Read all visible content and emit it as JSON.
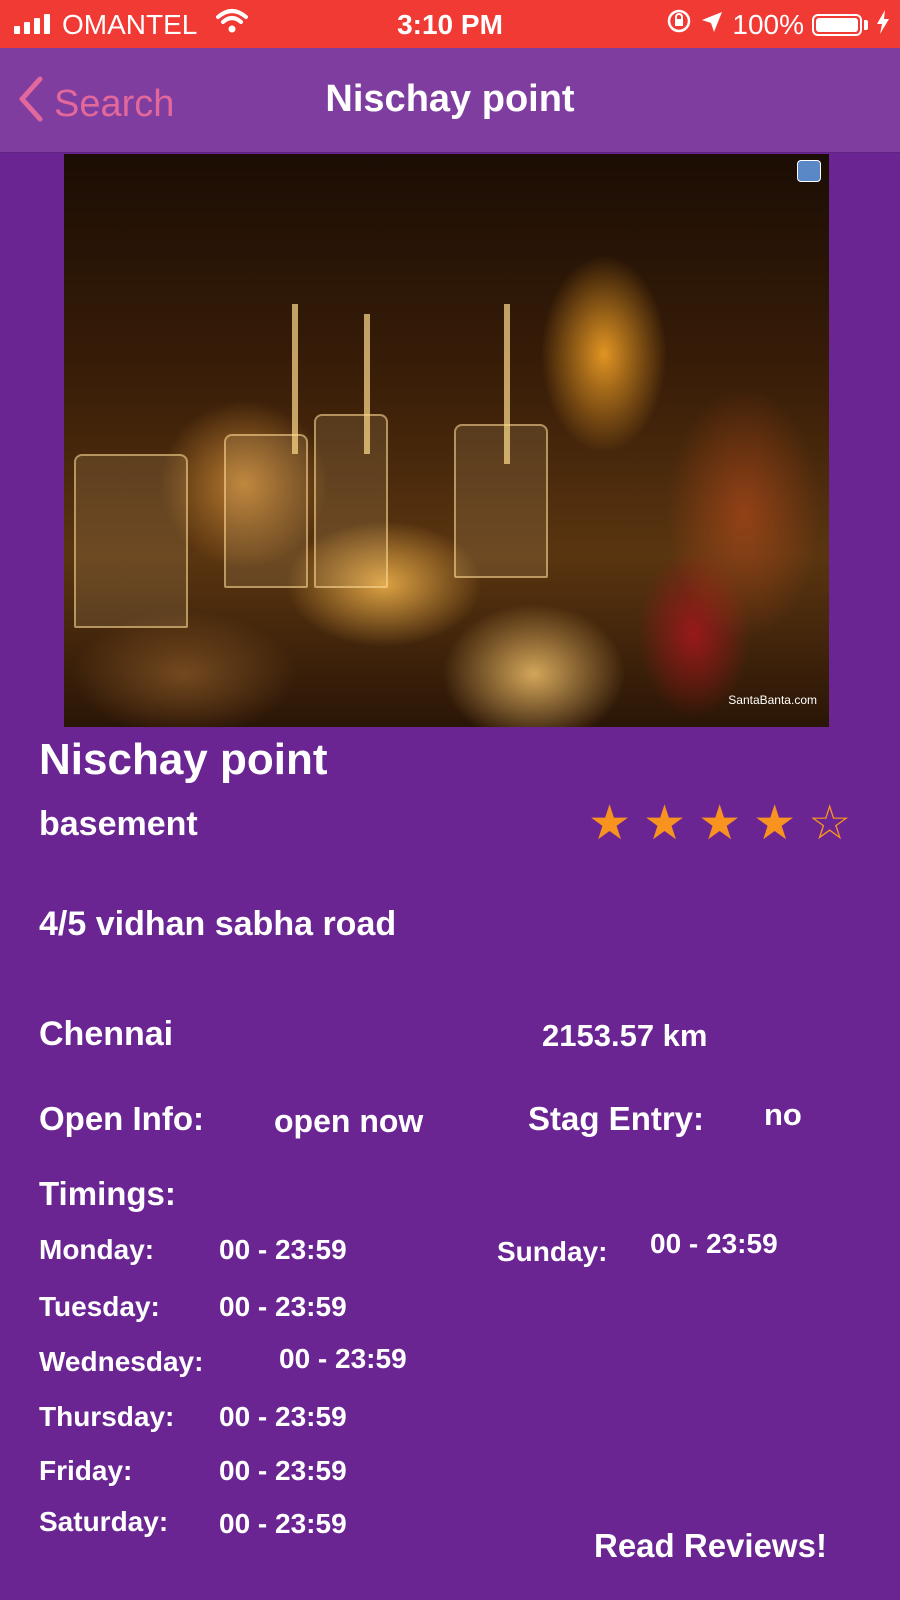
{
  "status_bar": {
    "carrier": "OMANTEL",
    "time": "3:10 PM",
    "battery_text": "100%",
    "battery_level": 1.0
  },
  "nav": {
    "back_label": "Search",
    "title": "Nischay point"
  },
  "hero": {
    "watermark": "SantaBanta.com"
  },
  "place": {
    "name": "Nischay point",
    "area": "basement",
    "rating": 4,
    "rating_max": 5,
    "address": "4/5 vidhan sabha road",
    "city": "Chennai",
    "distance": "2153.57 km"
  },
  "info": {
    "open_label": "Open Info:",
    "open_value": "open now",
    "stag_label": "Stag Entry:",
    "stag_value": "no"
  },
  "timings": {
    "label": "Timings:",
    "days": [
      {
        "day": "Monday:",
        "hours": "00 - 23:59"
      },
      {
        "day": "Tuesday:",
        "hours": "00 - 23:59"
      },
      {
        "day": "Wednesday:",
        "hours": "00 - 23:59"
      },
      {
        "day": "Thursday:",
        "hours": "00 - 23:59"
      },
      {
        "day": "Friday:",
        "hours": "00 - 23:59"
      },
      {
        "day": "Saturday:",
        "hours": "00 - 23:59"
      },
      {
        "day": "Sunday:",
        "hours": "00 - 23:59"
      }
    ]
  },
  "actions": {
    "read_reviews": "Read Reviews!"
  },
  "colors": {
    "background": "#6a2593",
    "status_bar": "#f23a35",
    "nav_bar": "#7f3da0",
    "back_accent": "#e2679b",
    "star": "#f7931e"
  }
}
